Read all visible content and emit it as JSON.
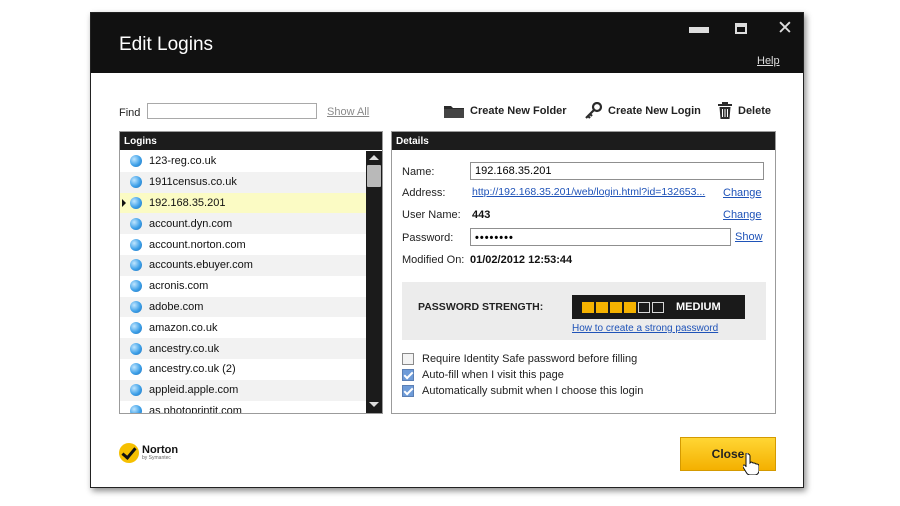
{
  "window": {
    "title": "Edit Logins",
    "help": "Help",
    "controls": [
      "minimize-icon",
      "maximize-icon",
      "close-icon"
    ]
  },
  "toolbar": {
    "find_label": "Find",
    "find_value": "",
    "show_all": "Show All",
    "create_folder": "Create New Folder",
    "create_login": "Create New Login",
    "delete": "Delete"
  },
  "logins": {
    "header": "Logins",
    "selected_index": 2,
    "items": [
      "123-reg.co.uk",
      "1911census.co.uk",
      "192.168.35.201",
      "account.dyn.com",
      "account.norton.com",
      "accounts.ebuyer.com",
      "acronis.com",
      "adobe.com",
      "amazon.co.uk",
      "ancestry.co.uk",
      "ancestry.co.uk (2)",
      "appleid.apple.com",
      "as.photoprintit.com"
    ]
  },
  "details": {
    "header": "Details",
    "name_label": "Name:",
    "name_value": "192.168.35.201",
    "address_label": "Address:",
    "address_value": "http://192.168.35.201/web/login.html?id=132653...",
    "username_label": "User Name:",
    "username_value": "443",
    "password_label": "Password:",
    "password_value": "••••••••",
    "modified_label": "Modified On:",
    "modified_value": "01/02/2012 12:53:44",
    "change": "Change",
    "show": "Show"
  },
  "strength": {
    "label": "PASSWORD STRENGTH:",
    "level": "MEDIUM",
    "filled_segments": 4,
    "total_segments": 6,
    "color": "#f5b200",
    "link": "How to create a strong password"
  },
  "options": [
    {
      "label": "Require Identity Safe password before filling",
      "checked": false
    },
    {
      "label": "Auto-fill when I visit this page",
      "checked": true
    },
    {
      "label": "Automatically submit when I choose this login",
      "checked": true
    }
  ],
  "footer": {
    "brand": "Norton",
    "brand_sub": "by Symantec",
    "close": "Close"
  }
}
